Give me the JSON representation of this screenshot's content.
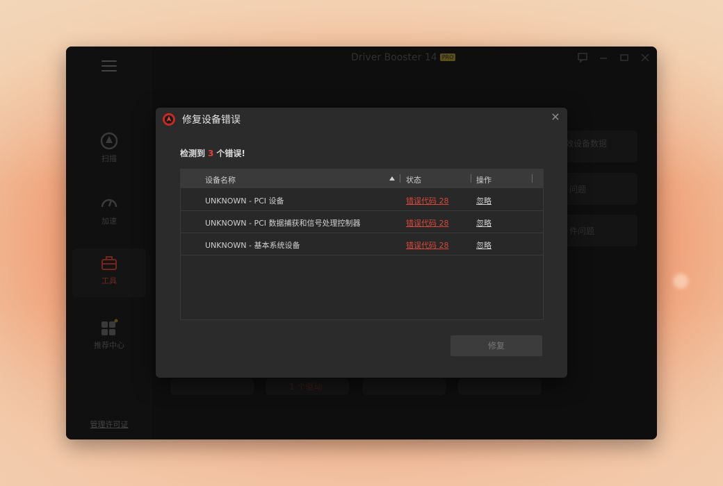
{
  "app": {
    "title": "Driver Booster 14",
    "badge": "PRO",
    "license_link": "管理许可证"
  },
  "sidebar": {
    "items": [
      {
        "label": "扫描",
        "icon": "scan-icon"
      },
      {
        "label": "加速",
        "icon": "speedometer-icon"
      },
      {
        "label": "工具",
        "icon": "toolbox-icon",
        "active": true
      },
      {
        "label": "推荐中心",
        "icon": "apps-grid-icon"
      }
    ]
  },
  "background_cards": {
    "card1_title": "效设备数据",
    "card2_title": "问题",
    "card3_title": "件问题",
    "bottom_card_text": "1 个驱动"
  },
  "dialog": {
    "title": "修复设备错误",
    "detect_prefix": "检测到",
    "detect_count": "3",
    "detect_suffix": "个错误!",
    "columns": {
      "name": "设备名称",
      "status": "状态",
      "action": "操作"
    },
    "rows": [
      {
        "name": "UNKNOWN - PCI 设备",
        "status": "错误代码 28",
        "action": "忽略"
      },
      {
        "name": "UNKNOWN - PCI 数据捕获和信号处理控制器",
        "status": "错误代码 28",
        "action": "忽略"
      },
      {
        "name": "UNKNOWN - 基本系统设备",
        "status": "错误代码 28",
        "action": "忽略"
      }
    ],
    "repair_button": "修复"
  },
  "colors": {
    "accent_red": "#e0433a",
    "dialog_bg": "#2b2b2b",
    "app_bg": "#121212"
  }
}
